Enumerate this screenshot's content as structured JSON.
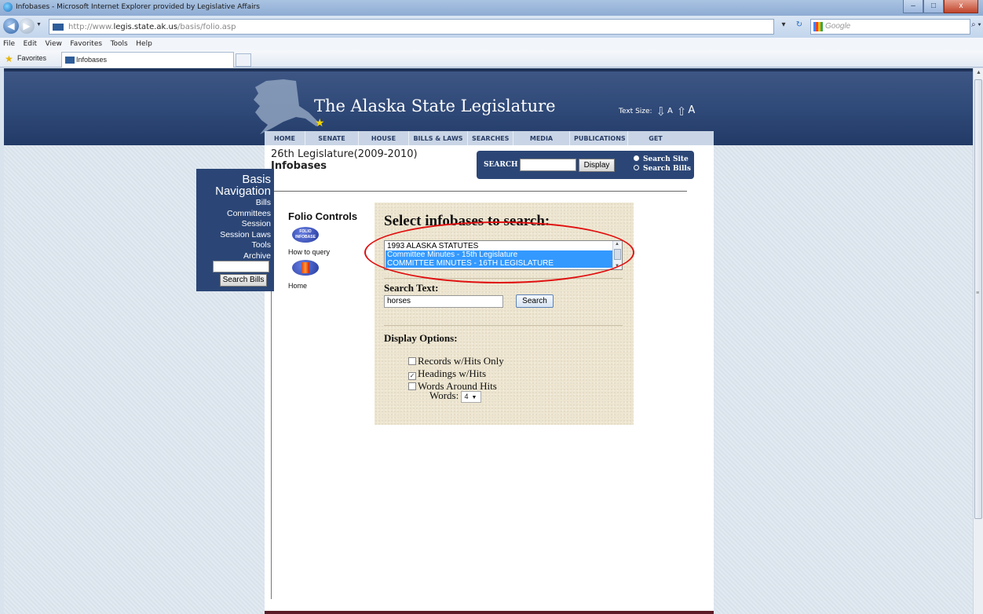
{
  "window": {
    "title": "Infobases - Microsoft Internet Explorer provided by Legislative Affairs",
    "controls": {
      "minimize": "–",
      "maximize": "□",
      "close": "x"
    }
  },
  "addressbar": {
    "url_prefix": "http://www.",
    "url_domain": "legis.state.ak.us",
    "url_path": "/basis/folio.asp",
    "search_placeholder": "Google"
  },
  "menu": [
    "File",
    "Edit",
    "View",
    "Favorites",
    "Tools",
    "Help"
  ],
  "favorites_bar": {
    "favorites_label": "Favorites",
    "tab_label": "Infobases"
  },
  "site": {
    "title": "The Alaska State Legislature",
    "text_size_label": "Text Size:",
    "text_size_small": "A",
    "text_size_large": "A",
    "nav": [
      "HOME",
      "SENATE",
      "HOUSE",
      "BILLS & LAWS",
      "SEARCHES",
      "MEDIA CENTER",
      "PUBLICATIONS",
      "GET STARTED"
    ]
  },
  "page": {
    "legislature": "26th Legislature(2009-2010)",
    "heading": "Infobases"
  },
  "site_search": {
    "label": "SEARCH",
    "button": "Display",
    "option_site": "Search Site",
    "option_bills": "Search Bills",
    "selected": "Search Site"
  },
  "basis_nav": {
    "title_line1": "Basis",
    "title_line2": "Navigation",
    "items": [
      "Bills",
      "Committees",
      "Session",
      "Session Laws",
      "Tools",
      "Archive"
    ],
    "button": "Search Bills"
  },
  "folio_controls": {
    "title": "Folio Controls",
    "infobase_icon_text": "FOLIO INFOBASE",
    "how_to_query": "How to query",
    "home": "Home"
  },
  "folio_form": {
    "title": "Select infobases to search:",
    "infobases": [
      {
        "label": "1993 ALASKA STATUTES",
        "selected": false
      },
      {
        "label": "Committee Minutes - 15th Legislature",
        "selected": true
      },
      {
        "label": "COMMITTEE MINUTES - 16TH LEGISLATURE",
        "selected": true
      }
    ],
    "search_text_label": "Search Text:",
    "search_text_value": "horses",
    "search_button": "Search",
    "display_options_label": "Display Options:",
    "options": [
      {
        "label": "Records w/Hits Only",
        "checked": false
      },
      {
        "label": "Headings w/Hits",
        "checked": true
      },
      {
        "label": "Words Around Hits",
        "checked": false
      }
    ],
    "words_label": "Words:",
    "words_value": "4"
  },
  "colors": {
    "header_blue": "#2e4877",
    "nav_panel": "#2b4676",
    "selection_blue": "#3399ff",
    "annotation_red": "#e01010",
    "folio_panel": "#ede5cf"
  }
}
